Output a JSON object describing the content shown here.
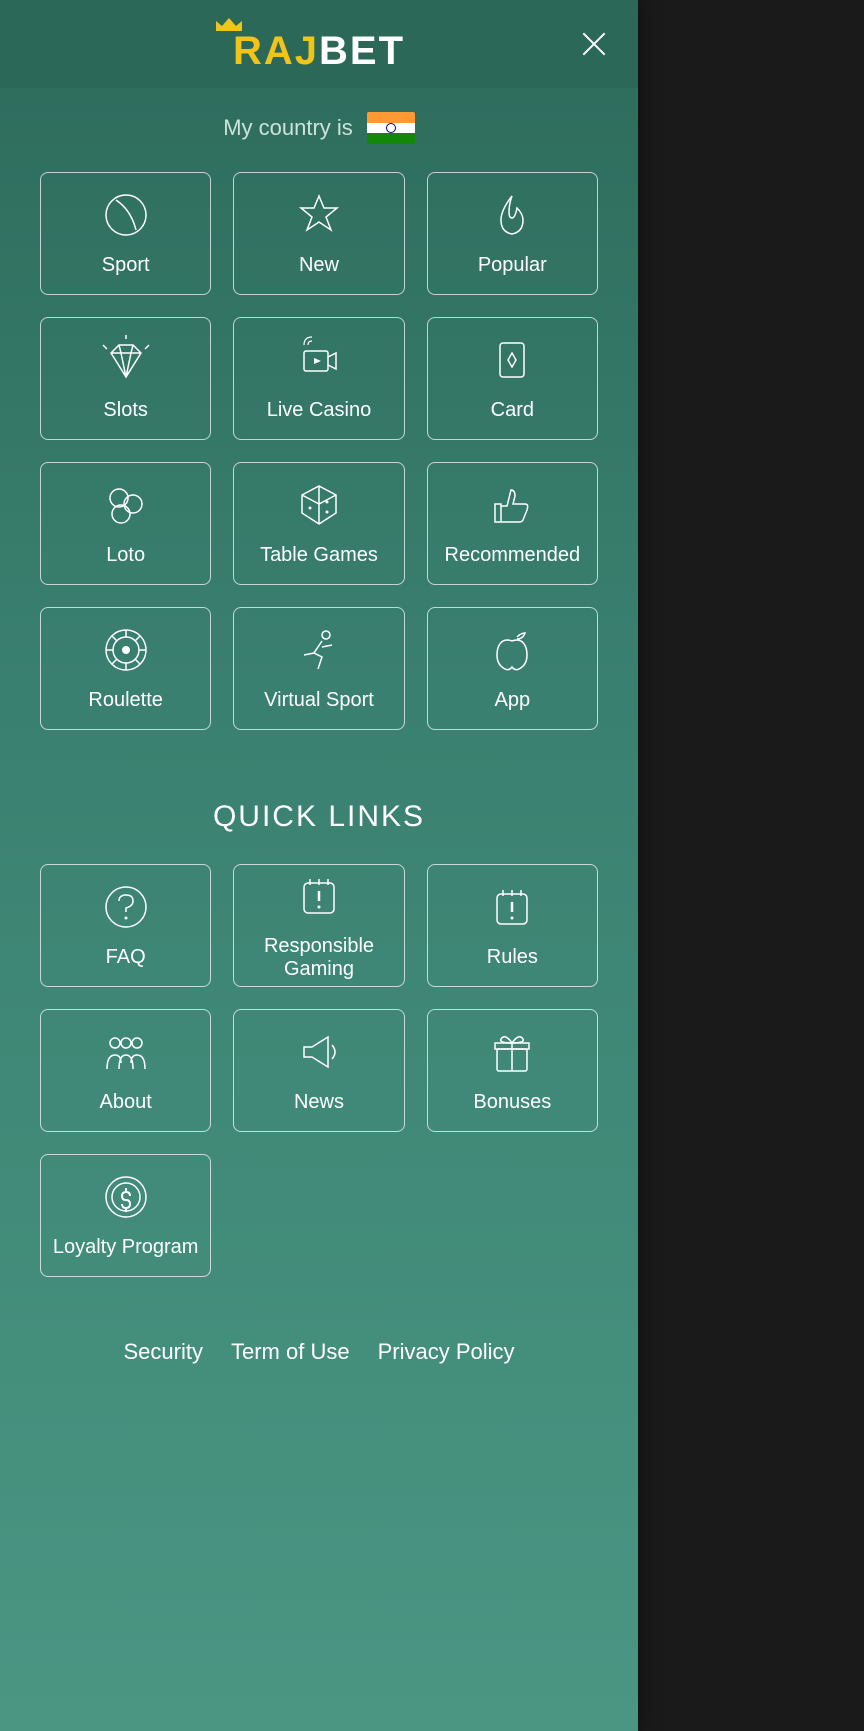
{
  "header": {
    "logo_raj": "RAJ",
    "logo_bet": "BET"
  },
  "country": {
    "label": "My country is",
    "flag": "india"
  },
  "categories": [
    {
      "id": "sport",
      "label": "Sport",
      "icon": "ball-icon"
    },
    {
      "id": "new",
      "label": "New",
      "icon": "star-icon"
    },
    {
      "id": "popular",
      "label": "Popular",
      "icon": "flame-icon"
    },
    {
      "id": "slots",
      "label": "Slots",
      "icon": "diamond-icon"
    },
    {
      "id": "live-casino",
      "label": "Live Casino",
      "icon": "live-camera-icon"
    },
    {
      "id": "card",
      "label": "Card",
      "icon": "card-icon"
    },
    {
      "id": "loto",
      "label": "Loto",
      "icon": "loto-balls-icon"
    },
    {
      "id": "table-games",
      "label": "Table Games",
      "icon": "dice-icon"
    },
    {
      "id": "recommended",
      "label": "Recommended",
      "icon": "thumbs-up-icon"
    },
    {
      "id": "roulette",
      "label": "Roulette",
      "icon": "roulette-icon"
    },
    {
      "id": "virtual-sport",
      "label": "Virtual Sport",
      "icon": "runner-icon"
    },
    {
      "id": "app",
      "label": "App",
      "icon": "apple-icon"
    }
  ],
  "quickLinksTitle": "QUICK LINKS",
  "quickLinks": [
    {
      "id": "faq",
      "label": "FAQ",
      "icon": "question-icon"
    },
    {
      "id": "responsible-gaming",
      "label": "Responsible Gaming",
      "icon": "calendar-alert-icon"
    },
    {
      "id": "rules",
      "label": "Rules",
      "icon": "calendar-alert-icon"
    },
    {
      "id": "about",
      "label": "About",
      "icon": "people-icon"
    },
    {
      "id": "news",
      "label": "News",
      "icon": "megaphone-icon"
    },
    {
      "id": "bonuses",
      "label": "Bonuses",
      "icon": "gift-icon"
    },
    {
      "id": "loyalty-program",
      "label": "Loyalty Program",
      "icon": "coin-icon"
    }
  ],
  "footerLinks": [
    {
      "id": "security",
      "label": "Security"
    },
    {
      "id": "term-of-use",
      "label": "Term of Use"
    },
    {
      "id": "privacy-policy",
      "label": "Privacy Policy"
    }
  ]
}
